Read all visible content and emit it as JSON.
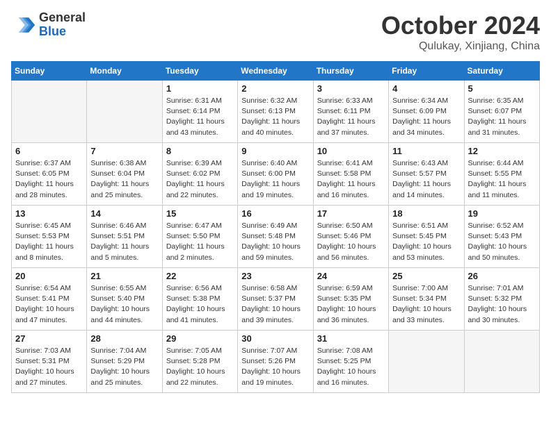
{
  "header": {
    "logo_line1": "General",
    "logo_line2": "Blue",
    "month": "October 2024",
    "location": "Qulukay, Xinjiang, China"
  },
  "weekdays": [
    "Sunday",
    "Monday",
    "Tuesday",
    "Wednesday",
    "Thursday",
    "Friday",
    "Saturday"
  ],
  "weeks": [
    [
      {
        "day": "",
        "info": ""
      },
      {
        "day": "",
        "info": ""
      },
      {
        "day": "1",
        "info": "Sunrise: 6:31 AM\nSunset: 6:14 PM\nDaylight: 11 hours and 43 minutes."
      },
      {
        "day": "2",
        "info": "Sunrise: 6:32 AM\nSunset: 6:13 PM\nDaylight: 11 hours and 40 minutes."
      },
      {
        "day": "3",
        "info": "Sunrise: 6:33 AM\nSunset: 6:11 PM\nDaylight: 11 hours and 37 minutes."
      },
      {
        "day": "4",
        "info": "Sunrise: 6:34 AM\nSunset: 6:09 PM\nDaylight: 11 hours and 34 minutes."
      },
      {
        "day": "5",
        "info": "Sunrise: 6:35 AM\nSunset: 6:07 PM\nDaylight: 11 hours and 31 minutes."
      }
    ],
    [
      {
        "day": "6",
        "info": "Sunrise: 6:37 AM\nSunset: 6:05 PM\nDaylight: 11 hours and 28 minutes."
      },
      {
        "day": "7",
        "info": "Sunrise: 6:38 AM\nSunset: 6:04 PM\nDaylight: 11 hours and 25 minutes."
      },
      {
        "day": "8",
        "info": "Sunrise: 6:39 AM\nSunset: 6:02 PM\nDaylight: 11 hours and 22 minutes."
      },
      {
        "day": "9",
        "info": "Sunrise: 6:40 AM\nSunset: 6:00 PM\nDaylight: 11 hours and 19 minutes."
      },
      {
        "day": "10",
        "info": "Sunrise: 6:41 AM\nSunset: 5:58 PM\nDaylight: 11 hours and 16 minutes."
      },
      {
        "day": "11",
        "info": "Sunrise: 6:43 AM\nSunset: 5:57 PM\nDaylight: 11 hours and 14 minutes."
      },
      {
        "day": "12",
        "info": "Sunrise: 6:44 AM\nSunset: 5:55 PM\nDaylight: 11 hours and 11 minutes."
      }
    ],
    [
      {
        "day": "13",
        "info": "Sunrise: 6:45 AM\nSunset: 5:53 PM\nDaylight: 11 hours and 8 minutes."
      },
      {
        "day": "14",
        "info": "Sunrise: 6:46 AM\nSunset: 5:51 PM\nDaylight: 11 hours and 5 minutes."
      },
      {
        "day": "15",
        "info": "Sunrise: 6:47 AM\nSunset: 5:50 PM\nDaylight: 11 hours and 2 minutes."
      },
      {
        "day": "16",
        "info": "Sunrise: 6:49 AM\nSunset: 5:48 PM\nDaylight: 10 hours and 59 minutes."
      },
      {
        "day": "17",
        "info": "Sunrise: 6:50 AM\nSunset: 5:46 PM\nDaylight: 10 hours and 56 minutes."
      },
      {
        "day": "18",
        "info": "Sunrise: 6:51 AM\nSunset: 5:45 PM\nDaylight: 10 hours and 53 minutes."
      },
      {
        "day": "19",
        "info": "Sunrise: 6:52 AM\nSunset: 5:43 PM\nDaylight: 10 hours and 50 minutes."
      }
    ],
    [
      {
        "day": "20",
        "info": "Sunrise: 6:54 AM\nSunset: 5:41 PM\nDaylight: 10 hours and 47 minutes."
      },
      {
        "day": "21",
        "info": "Sunrise: 6:55 AM\nSunset: 5:40 PM\nDaylight: 10 hours and 44 minutes."
      },
      {
        "day": "22",
        "info": "Sunrise: 6:56 AM\nSunset: 5:38 PM\nDaylight: 10 hours and 41 minutes."
      },
      {
        "day": "23",
        "info": "Sunrise: 6:58 AM\nSunset: 5:37 PM\nDaylight: 10 hours and 39 minutes."
      },
      {
        "day": "24",
        "info": "Sunrise: 6:59 AM\nSunset: 5:35 PM\nDaylight: 10 hours and 36 minutes."
      },
      {
        "day": "25",
        "info": "Sunrise: 7:00 AM\nSunset: 5:34 PM\nDaylight: 10 hours and 33 minutes."
      },
      {
        "day": "26",
        "info": "Sunrise: 7:01 AM\nSunset: 5:32 PM\nDaylight: 10 hours and 30 minutes."
      }
    ],
    [
      {
        "day": "27",
        "info": "Sunrise: 7:03 AM\nSunset: 5:31 PM\nDaylight: 10 hours and 27 minutes."
      },
      {
        "day": "28",
        "info": "Sunrise: 7:04 AM\nSunset: 5:29 PM\nDaylight: 10 hours and 25 minutes."
      },
      {
        "day": "29",
        "info": "Sunrise: 7:05 AM\nSunset: 5:28 PM\nDaylight: 10 hours and 22 minutes."
      },
      {
        "day": "30",
        "info": "Sunrise: 7:07 AM\nSunset: 5:26 PM\nDaylight: 10 hours and 19 minutes."
      },
      {
        "day": "31",
        "info": "Sunrise: 7:08 AM\nSunset: 5:25 PM\nDaylight: 10 hours and 16 minutes."
      },
      {
        "day": "",
        "info": ""
      },
      {
        "day": "",
        "info": ""
      }
    ]
  ]
}
